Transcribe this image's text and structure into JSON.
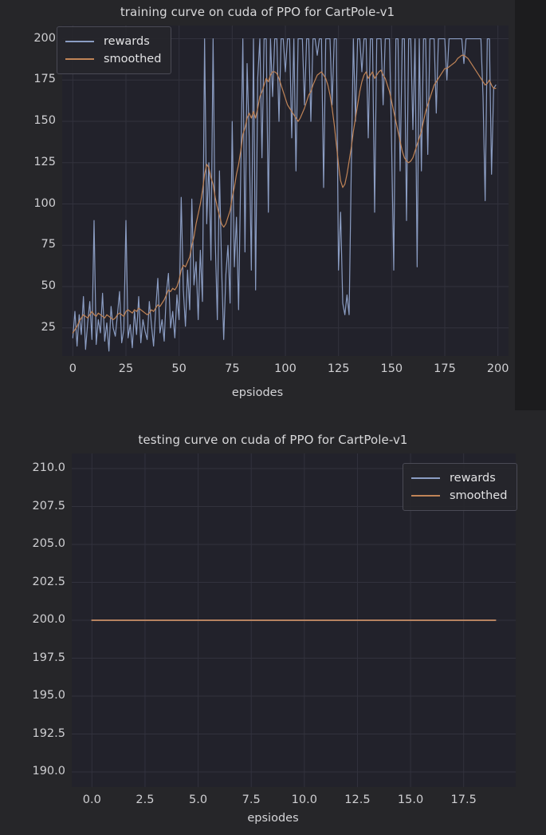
{
  "page": {
    "background_color": "#1c1c1e",
    "figure_background_color": "#262629",
    "plot_background_color": "#22222b",
    "grid_color": "#32323d",
    "text_color": "#d5d5d8"
  },
  "colors": {
    "rewards": "#8b9dc3",
    "smoothed": "#c08457"
  },
  "legend": {
    "rewards_label": "rewards",
    "smoothed_label": "smoothed"
  },
  "chart_data": [
    {
      "id": "training",
      "type": "line",
      "title": "training curve on cuda of PPO for CartPole-v1",
      "xlabel": "epsiodes",
      "ylabel": "",
      "xlim": [
        -5,
        205
      ],
      "ylim": [
        8,
        208
      ],
      "xticks": [
        0,
        25,
        50,
        75,
        100,
        125,
        150,
        175,
        200
      ],
      "xticklabels": [
        "0",
        "25",
        "50",
        "75",
        "100",
        "125",
        "150",
        "175",
        "200"
      ],
      "yticks": [
        25,
        50,
        75,
        100,
        125,
        150,
        175,
        200
      ],
      "yticklabels": [
        "25",
        "50",
        "75",
        "100",
        "125",
        "150",
        "175",
        "200"
      ],
      "grid": true,
      "legend_position": "upper left",
      "series": [
        {
          "name": "rewards",
          "color": "#8b9dc3",
          "values": [
            19,
            35,
            14,
            33,
            21,
            44,
            12,
            28,
            41,
            18,
            90,
            15,
            30,
            22,
            46,
            17,
            28,
            11,
            38,
            25,
            20,
            33,
            47,
            16,
            24,
            90,
            19,
            27,
            13,
            35,
            21,
            44,
            16,
            30,
            23,
            18,
            41,
            27,
            14,
            36,
            55,
            22,
            30,
            17,
            46,
            58,
            25,
            35,
            19,
            45,
            30,
            104,
            48,
            26,
            60,
            36,
            103,
            51,
            65,
            30,
            72,
            41,
            200,
            88,
            125,
            66,
            200,
            79,
            30,
            120,
            62,
            18,
            57,
            75,
            40,
            150,
            62,
            92,
            36,
            118,
            200,
            71,
            185,
            140,
            60,
            200,
            48,
            176,
            200,
            128,
            200,
            200,
            95,
            200,
            165,
            200,
            200,
            150,
            200,
            200,
            180,
            200,
            200,
            140,
            200,
            120,
            200,
            200,
            200,
            160,
            200,
            200,
            150,
            200,
            200,
            190,
            200,
            200,
            110,
            200,
            200,
            200,
            160,
            200,
            200,
            60,
            95,
            40,
            33,
            45,
            33,
            120,
            200,
            150,
            200,
            200,
            180,
            200,
            200,
            140,
            200,
            200,
            95,
            200,
            200,
            200,
            160,
            200,
            200,
            200,
            135,
            60,
            200,
            200,
            120,
            200,
            200,
            90,
            200,
            200,
            145,
            200,
            62,
            200,
            120,
            200,
            200,
            130,
            200,
            200,
            200,
            155,
            200,
            200,
            200,
            200,
            175,
            200,
            200,
            200,
            200,
            200,
            200,
            200,
            185,
            200,
            200,
            200,
            200,
            200,
            200,
            200,
            200,
            165,
            102,
            200,
            200,
            118,
            170,
            172
          ]
        },
        {
          "name": "smoothed",
          "color": "#c08457",
          "values": [
            22,
            24,
            26,
            29,
            31,
            33,
            32,
            31,
            33,
            35,
            33,
            32,
            34,
            33,
            32,
            31,
            33,
            32,
            31,
            30,
            31,
            33,
            34,
            33,
            32,
            35,
            36,
            35,
            34,
            36,
            35,
            37,
            36,
            35,
            34,
            33,
            34,
            36,
            35,
            37,
            39,
            38,
            40,
            42,
            45,
            48,
            47,
            49,
            48,
            50,
            54,
            60,
            63,
            62,
            65,
            68,
            75,
            80,
            88,
            94,
            100,
            108,
            118,
            124,
            122,
            116,
            112,
            104,
            98,
            93,
            88,
            86,
            88,
            92,
            96,
            104,
            110,
            118,
            124,
            132,
            142,
            146,
            152,
            155,
            152,
            156,
            152,
            158,
            165,
            168,
            172,
            176,
            174,
            178,
            180,
            180,
            179,
            176,
            172,
            168,
            164,
            160,
            158,
            156,
            154,
            152,
            150,
            152,
            155,
            158,
            162,
            166,
            168,
            172,
            175,
            178,
            179,
            180,
            178,
            176,
            172,
            166,
            158,
            148,
            136,
            124,
            114,
            110,
            112,
            118,
            126,
            134,
            144,
            152,
            160,
            168,
            174,
            178,
            180,
            176,
            178,
            180,
            176,
            178,
            180,
            181,
            178,
            176,
            172,
            168,
            162,
            156,
            150,
            144,
            138,
            132,
            128,
            126,
            125,
            126,
            128,
            132,
            136,
            140,
            144,
            150,
            156,
            160,
            164,
            168,
            172,
            174,
            176,
            178,
            180,
            182,
            182,
            183,
            184,
            185,
            186,
            188,
            189,
            190,
            190,
            189,
            188,
            186,
            184,
            182,
            180,
            178,
            176,
            174,
            172,
            173,
            175,
            172,
            170,
            170
          ]
        }
      ]
    },
    {
      "id": "testing",
      "type": "line",
      "title": "testing curve on cuda of PPO for CartPole-v1",
      "xlabel": "epsiodes",
      "ylabel": "",
      "xlim": [
        -0.95,
        19.95
      ],
      "ylim": [
        189.0,
        211.0
      ],
      "xticks": [
        0.0,
        2.5,
        5.0,
        7.5,
        10.0,
        12.5,
        15.0,
        17.5
      ],
      "xticklabels": [
        "0.0",
        "2.5",
        "5.0",
        "7.5",
        "10.0",
        "12.5",
        "15.0",
        "17.5"
      ],
      "yticks": [
        190.0,
        192.5,
        195.0,
        197.5,
        200.0,
        202.5,
        205.0,
        207.5,
        210.0
      ],
      "yticklabels": [
        "190.0",
        "192.5",
        "195.0",
        "197.5",
        "200.0",
        "202.5",
        "205.0",
        "207.5",
        "210.0"
      ],
      "grid": true,
      "legend_position": "upper right",
      "series": [
        {
          "name": "rewards",
          "color": "#8b9dc3",
          "values": [
            200,
            200,
            200,
            200,
            200,
            200,
            200,
            200,
            200,
            200,
            200,
            200,
            200,
            200,
            200,
            200,
            200,
            200,
            200,
            200
          ]
        },
        {
          "name": "smoothed",
          "color": "#c08457",
          "values": [
            200,
            200,
            200,
            200,
            200,
            200,
            200,
            200,
            200,
            200,
            200,
            200,
            200,
            200,
            200,
            200,
            200,
            200,
            200,
            200
          ]
        }
      ]
    }
  ]
}
